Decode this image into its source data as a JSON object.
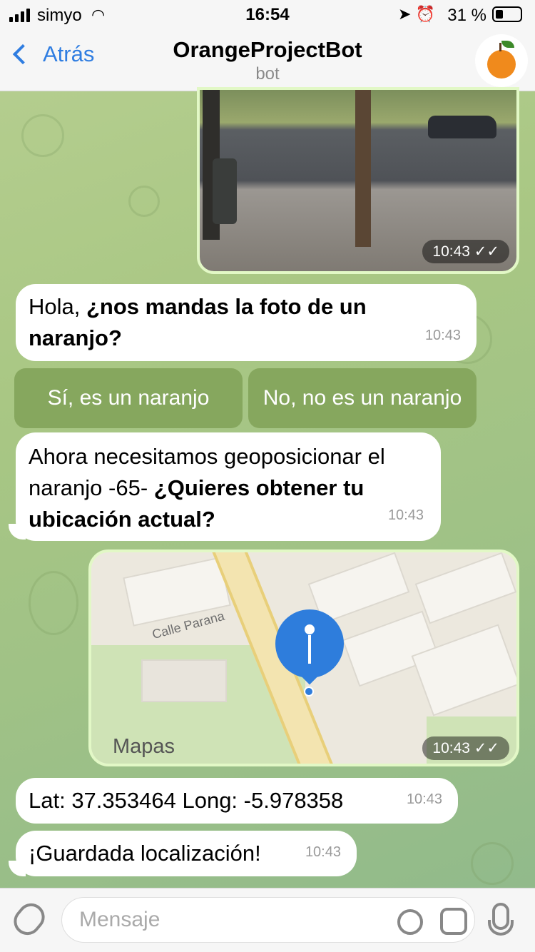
{
  "status": {
    "carrier": "simyo",
    "time": "16:54",
    "battery": "31 %"
  },
  "header": {
    "back_label": "Atrás",
    "title": "OrangeProjectBot",
    "subtitle": "bot"
  },
  "messages": {
    "photo_time": "10:43",
    "m1_prefix": "Hola, ",
    "m1_bold": "¿nos mandas la foto de un naranjo?",
    "m1_time": "10:43",
    "btn_yes": "Sí, es un naranjo",
    "btn_no": "No, no es un naranjo",
    "m2_prefix": "Ahora necesitamos geoposicionar el naranjo -65- ",
    "m2_bold": "¿Quieres obtener tu ubicación actual?",
    "m2_time": "10:43",
    "map_street": "Calle Parana",
    "map_logo": "Mapas",
    "map_time": "10:43",
    "m3": "Lat: 37.353464 Long: -5.978358",
    "m3_time": "10:43",
    "m4": "¡Guardada localización!",
    "m4_time": "10:43"
  },
  "input": {
    "placeholder": "Mensaje"
  }
}
